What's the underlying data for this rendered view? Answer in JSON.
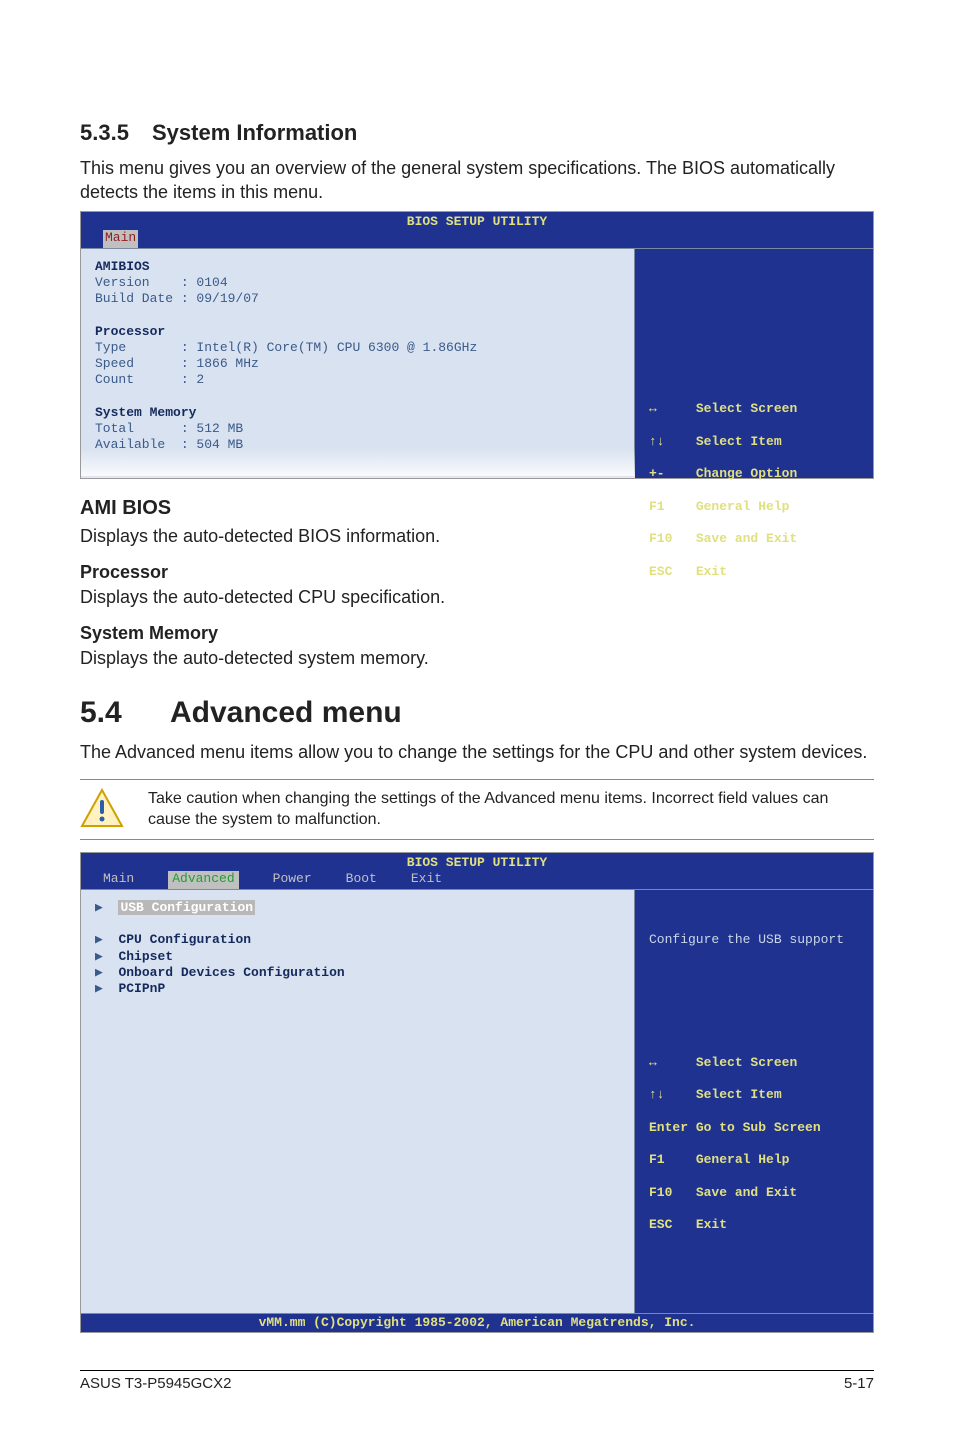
{
  "section535": {
    "num": "5.3.5",
    "title": "System Information",
    "intro": "This menu gives you an overview of the general system specifications. The BIOS automatically detects the items in this menu."
  },
  "bios1": {
    "title": "BIOS SETUP UTILITY",
    "tab_main": "Main",
    "amibios_hdr": "AMIBIOS",
    "version_row": "Version    : 0104",
    "builddate_row": "Build Date : 09/19/07",
    "processor_hdr": "Processor",
    "type_row": "Type       : Intel(R) Core(TM) CPU 6300 @ 1.86GHz",
    "speed_row": "Speed      : 1866 MHz",
    "count_row": "Count      : 2",
    "sysmem_hdr": "System Memory",
    "total_row": "Total      : 512 MB",
    "available_row": "Available  : 504 MB",
    "help": [
      [
        "↔",
        "Select Screen"
      ],
      [
        "↑↓",
        "Select Item"
      ],
      [
        "+-",
        "Change Option"
      ],
      [
        "F1",
        "General Help"
      ],
      [
        "F10",
        "Save and Exit"
      ],
      [
        "ESC",
        "Exit"
      ]
    ]
  },
  "headings": {
    "ami_bios": "AMI BIOS",
    "ami_bios_text": "Displays the auto-detected BIOS information.",
    "processor": "Processor",
    "processor_text": "Displays the auto-detected CPU specification.",
    "sysmem": "System Memory",
    "sysmem_text": "Displays the auto-detected system memory."
  },
  "section54": {
    "num": "5.4",
    "title": "Advanced menu",
    "intro": "The Advanced menu items allow you to change the settings for the CPU and other system devices.",
    "caution": "Take caution when changing the settings of the Advanced menu items. Incorrect field values can cause the system to malfunction."
  },
  "bios2": {
    "title": "BIOS SETUP UTILITY",
    "tabs": [
      "Main",
      "Advanced",
      "Power",
      "Boot",
      "Exit"
    ],
    "active_tab": "Advanced",
    "items": [
      "USB Configuration",
      "CPU Configuration",
      "Chipset",
      "Onboard Devices Configuration",
      "PCIPnP"
    ],
    "help_desc": "Configure the USB support",
    "help": [
      [
        "↔",
        "Select Screen"
      ],
      [
        "↑↓",
        "Select Item"
      ],
      [
        "Enter",
        "Go to Sub Screen"
      ],
      [
        "F1",
        "General Help"
      ],
      [
        "F10",
        "Save and Exit"
      ],
      [
        "ESC",
        "Exit"
      ]
    ],
    "footer": "vMM.mm (C)Copyright 1985-2002, American Megatrends, Inc."
  },
  "footer": {
    "product": "ASUS T3-P5945GCX2",
    "page": "5-17"
  }
}
